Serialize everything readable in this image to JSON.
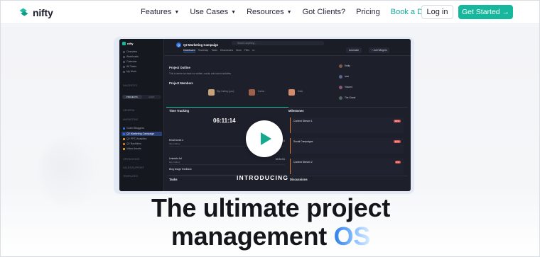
{
  "nav": {
    "brand": "nifty",
    "links": [
      {
        "label": "Features",
        "dropdown": true
      },
      {
        "label": "Use Cases",
        "dropdown": true
      },
      {
        "label": "Resources",
        "dropdown": true
      },
      {
        "label": "Got Clients?",
        "dropdown": false
      },
      {
        "label": "Pricing",
        "dropdown": false
      },
      {
        "label": "Book a Demo",
        "dropdown": false,
        "accent": true
      }
    ],
    "login_label": "Log in",
    "start_label": "Get Started →"
  },
  "video": {
    "overlay_label": "INTRODUCING",
    "app": {
      "brand": "nifty",
      "sidebar": [
        "Overview",
        "Workloads",
        "Calendar",
        "All Tasks",
        "My Work"
      ],
      "favorites_label": "FAVORITES",
      "toggle": [
        "PROJECTS",
        "CHAT"
      ],
      "general_label": "GENERAL",
      "marketing_label": "MARKETING",
      "projects": [
        "Guest Bloggers",
        "Q2 Marketing Campaign",
        "Q2 PPC Analytics",
        "Q2 Backlinks",
        "Video Assets"
      ],
      "sections": [
        "OPERATIONS",
        "SALES/SUPPORT",
        "TEMPLATES"
      ],
      "project_title": "Q2 Marketing Campaign",
      "tabs": [
        "Dashboard",
        "Roadmap",
        "Tasks",
        "Discussions",
        "Docs",
        "Files",
        "•••"
      ],
      "search_placeholder": "Search anything...",
      "automate_label": "Automate",
      "add_widgets_label": "+ Add Widgets",
      "outline_title": "Project Outline",
      "outline_text": "This is where we track our written, social, and sound activities",
      "members_title": "Project Members",
      "members": [
        "Sky Cathey (you)",
        "Carlos",
        "Katie"
      ],
      "activity": [
        "Emily",
        "Ivan",
        "Vincent",
        "The Grand"
      ],
      "time_tracking_title": "Time Tracking",
      "timer": "06:11:14",
      "tasks": [
        {
          "title": "Email week 2",
          "sub": "Sky Cathey",
          "time": "02:46:51"
        },
        {
          "title": "LinkedIn Ad",
          "sub": "Sky Cathey",
          "time": "02:54:51"
        },
        {
          "title": "Blog image feedback",
          "sub": "",
          "time": ""
        }
      ],
      "milestones_title": "Milestones",
      "milestones": [
        {
          "title": "Content Stream 1",
          "pct": "16%"
        },
        {
          "title": "Social Campaigns",
          "pct": "10%"
        },
        {
          "title": "Content Stream 2",
          "pct": "4%"
        }
      ],
      "bottom": [
        "Tasks",
        "Discussions"
      ]
    }
  },
  "hero": {
    "line1": "The ultimate project",
    "line2_prefix": "management ",
    "line2_accent": "OS"
  }
}
